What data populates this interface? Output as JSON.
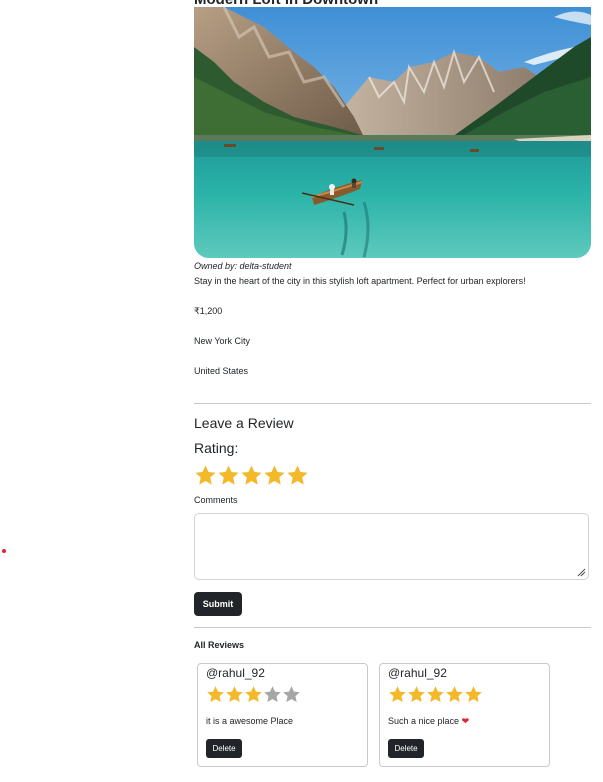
{
  "listing": {
    "title": "Modern Loft in Downtown",
    "owner": "Owned by: delta-student",
    "description": "Stay in the heart of the city in this stylish loft apartment. Perfect for urban explorers!",
    "price": "₹1,200",
    "location": "New York City",
    "country": "United States"
  },
  "review_form": {
    "heading": "Leave a Review",
    "rating_label": "Rating:",
    "rating": 5,
    "rating_max": 5,
    "comments_label": "Comments",
    "comments_value": "",
    "submit_label": "Submit"
  },
  "reviews": {
    "heading": "All Reviews",
    "items": [
      {
        "author": "@rahul_92",
        "rating": 3,
        "text": "it is a awesome Place",
        "delete_label": "Delete"
      },
      {
        "author": "@rahul_92",
        "rating": 5,
        "text": "Such a nice place",
        "delete_label": "Delete"
      }
    ]
  },
  "colors": {
    "star_filled": "#f4b82b",
    "star_empty": "#a6a6a6",
    "button_dark": "#212529",
    "heart": "#e0242d"
  },
  "icons": {
    "star": "star-icon",
    "heart": "heart-icon",
    "resize": "resize-handle-icon"
  }
}
